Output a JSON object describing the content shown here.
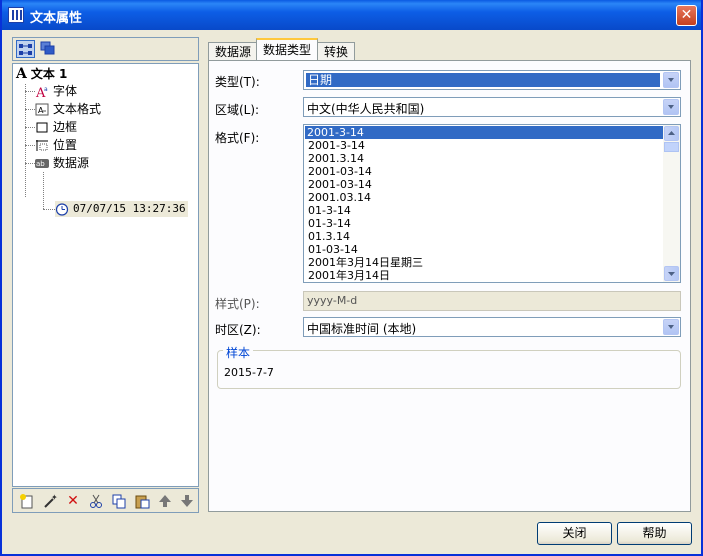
{
  "window": {
    "title": "文本属性"
  },
  "left_toolbar": {
    "buttons": [
      "tree-view-icon",
      "layers-icon"
    ]
  },
  "tree": {
    "root": {
      "label": "文本 1",
      "icon": "A"
    },
    "children": [
      {
        "label": "字体",
        "icon": "font-icon"
      },
      {
        "label": "文本格式",
        "icon": "text-format-icon"
      },
      {
        "label": "边框",
        "icon": "border-icon"
      },
      {
        "label": "位置",
        "icon": "position-icon"
      },
      {
        "label": "数据源",
        "icon": "data-source-icon"
      }
    ],
    "datasource_child": {
      "label": "07/07/15 13:27:36",
      "icon": "clock-icon"
    }
  },
  "bottom_toolbar": [
    "new-icon",
    "wand-icon",
    "delete-icon",
    "cut-icon",
    "copy-icon",
    "paste-icon",
    "up-arrow-icon",
    "down-arrow-icon"
  ],
  "tabs": [
    {
      "label": "数据源",
      "active": false
    },
    {
      "label": "数据类型",
      "active": true
    },
    {
      "label": "转换",
      "active": false
    }
  ],
  "form": {
    "type_label": "类型(T):",
    "type_value": "日期",
    "region_label": "区域(L):",
    "region_value": "中文(中华人民共和国)",
    "format_label": "格式(F):",
    "format_items": [
      "2001-3-14",
      "2001-3-14",
      "2001.3.14",
      "2001-03-14",
      "2001-03-14",
      "2001.03.14",
      "01-3-14",
      "01-3-14",
      "01.3.14",
      "01-03-14",
      "2001年3月14日星期三",
      "2001年3月14日"
    ],
    "format_selected_index": 0,
    "style_label": "样式(P):",
    "style_value": "yyyy-M-d",
    "timezone_label": "时区(Z):",
    "timezone_value": "中国标准时间 (本地)",
    "sample_title": "样本",
    "sample_value": "2015-7-7"
  },
  "buttons": {
    "close": "关闭",
    "help": "帮助"
  }
}
